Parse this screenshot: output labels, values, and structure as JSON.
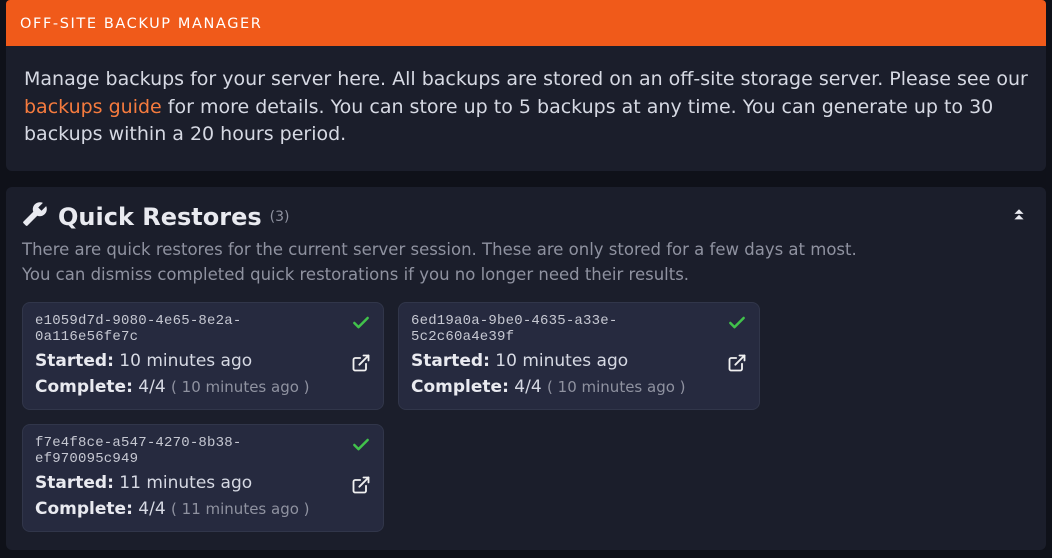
{
  "banner": {
    "title": "OFF-SITE BACKUP MANAGER"
  },
  "description": {
    "pre": "Manage backups for your server here. All backups are stored on an off-site storage server. Please see our ",
    "link": "backups guide",
    "post": " for more details. You can store up to 5 backups at any time. You can generate up to 30 backups within a 20 hours period."
  },
  "quick": {
    "title": "Quick Restores",
    "count_display": "(3)",
    "sub_line1": "There are quick restores for the current server session. These are only stored for a few days at most.",
    "sub_line2": "You can dismiss completed quick restorations if you no longer need their results.",
    "started_label": "Started",
    "complete_label": "Complete",
    "items": [
      {
        "hash": "e1059d7d-9080-4e65-8e2a-0a116e56fe7c",
        "started": "10 minutes ago",
        "complete": "4/4",
        "complete_when": "( 10 minutes ago )"
      },
      {
        "hash": "6ed19a0a-9be0-4635-a33e-5c2c60a4e39f",
        "started": "10 minutes ago",
        "complete": "4/4",
        "complete_when": "( 10 minutes ago )"
      },
      {
        "hash": "f7e4f8ce-a547-4270-8b38-ef970095c949",
        "started": "11 minutes ago",
        "complete": "4/4",
        "complete_when": "( 11 minutes ago )"
      }
    ]
  }
}
